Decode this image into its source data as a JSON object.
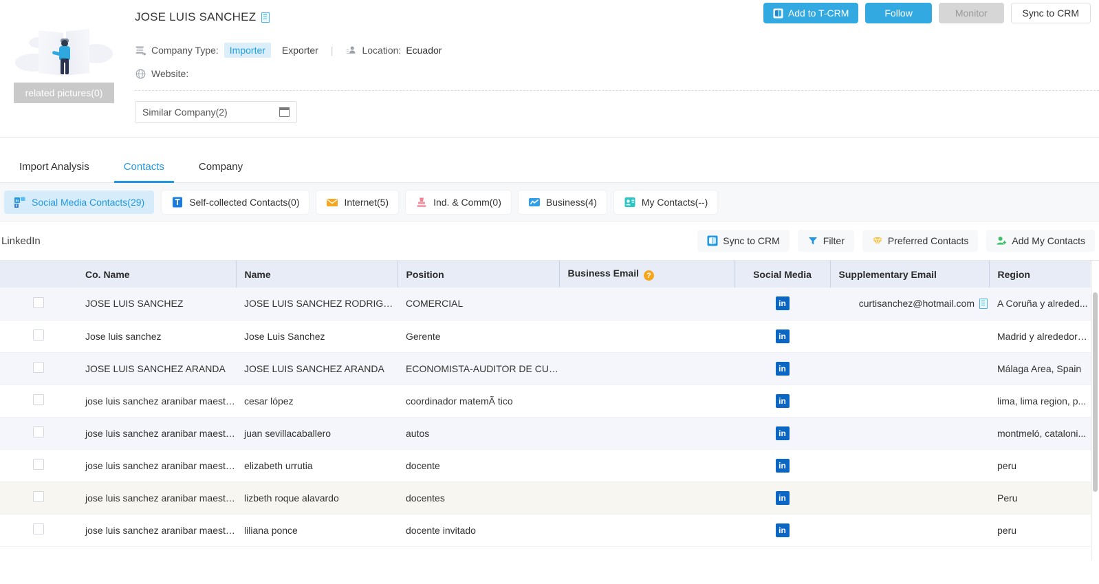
{
  "profile": {
    "thumb_caption": "related pictures(0)",
    "thumb_icon": "person-placeholder-illustration",
    "company_name": "JOSE LUIS SANCHEZ",
    "copy_icon": "copy-icon",
    "company_type_label": "Company Type:",
    "company_type_importer": "Importer",
    "company_type_exporter": "Exporter",
    "divider": "|",
    "location_label": "Location:",
    "location_value": "Ecuador",
    "website_label": "Website:",
    "website_value": "",
    "company_type_icon": "import-export-icon",
    "location_icon": "location-person-icon",
    "website_icon": "globe-icon",
    "similar_company": "Similar Company(2)",
    "similar_company_icon": "calendar-icon"
  },
  "header_actions": [
    {
      "label": "Add to T-CRM",
      "icon": "crm-icon",
      "style": "primary-icon"
    },
    {
      "label": "Follow",
      "icon": "",
      "style": "primary"
    },
    {
      "label": "Monitor",
      "icon": "",
      "style": "disabled"
    },
    {
      "label": "Sync to CRM",
      "icon": "",
      "style": "outline"
    }
  ],
  "tabs": [
    {
      "label": "Import Analysis",
      "active": false
    },
    {
      "label": "Contacts",
      "active": true
    },
    {
      "label": "Company",
      "active": false
    }
  ],
  "chips": [
    {
      "label": "Social Media Contacts(29)",
      "icon": "social-media-icon",
      "active": true
    },
    {
      "label": "Self-collected Contacts(0)",
      "icon": "t-square-icon",
      "active": false
    },
    {
      "label": "Internet(5)",
      "icon": "envelope-icon",
      "active": false
    },
    {
      "label": "Ind. & Comm(0)",
      "icon": "stamp-icon",
      "active": false
    },
    {
      "label": "Business(4)",
      "icon": "chart-icon",
      "active": false
    },
    {
      "label": "My Contacts(--)",
      "icon": "contact-card-icon",
      "active": false
    }
  ],
  "list_toolbar": {
    "source_label": "LinkedIn",
    "buttons": [
      {
        "label": "Sync to CRM",
        "icon": "crm-icon"
      },
      {
        "label": "Filter",
        "icon": "funnel-icon"
      },
      {
        "label": "Preferred Contacts",
        "icon": "diamond-icon"
      },
      {
        "label": "Add My Contacts",
        "icon": "add-person-icon"
      }
    ]
  },
  "table": {
    "columns": [
      "Co. Name",
      "Name",
      "Position",
      "Business Email",
      "Social Media",
      "Supplementary Email",
      "Region"
    ],
    "business_email_help_icon": "help-icon",
    "rows": [
      {
        "co_name": "JOSE LUIS SANCHEZ",
        "name": "JOSE LUIS SANCHEZ RODRIGUEZ",
        "position": "COMERCIAL",
        "business_email": "",
        "social_media": "in",
        "supplementary_email": "curtisanchez@hotmail.com",
        "supplementary_email_copy_icon": "copy-icon",
        "region": "A Coruña y alreded..."
      },
      {
        "co_name": "Jose luis sanchez",
        "name": "Jose Luis Sanchez",
        "position": "Gerente",
        "business_email": "",
        "social_media": "in",
        "supplementary_email": "",
        "region": "Madrid y alrededore..."
      },
      {
        "co_name": "JOSE LUIS SANCHEZ ARANDA",
        "name": "JOSE LUIS SANCHEZ ARANDA",
        "position": "ECONOMISTA-AUDITOR DE CUENTAS",
        "business_email": "",
        "social_media": "in",
        "supplementary_email": "",
        "region": "Málaga Area, Spain"
      },
      {
        "co_name": "jose luis sanchez aranibar maestranza y...",
        "name": "cesar lópez",
        "position": "coordinador matemÃ tico",
        "business_email": "",
        "social_media": "in",
        "supplementary_email": "",
        "region": "lima, lima region, p..."
      },
      {
        "co_name": "jose luis sanchez aranibar maestranza y...",
        "name": "juan sevillacaballero",
        "position": "autos",
        "business_email": "",
        "social_media": "in",
        "supplementary_email": "",
        "region": "montmeló, cataloni..."
      },
      {
        "co_name": "jose luis sanchez aranibar maestranza y...",
        "name": "elizabeth urrutia",
        "position": "docente",
        "business_email": "",
        "social_media": "in",
        "supplementary_email": "",
        "region": "peru"
      },
      {
        "co_name": "jose luis sanchez aranibar maestranza y...",
        "name": "lizbeth roque alavardo",
        "position": "docentes",
        "business_email": "",
        "social_media": "in",
        "supplementary_email": "",
        "region": "Peru"
      },
      {
        "co_name": "jose luis sanchez aranibar maestranza y...",
        "name": "liliana ponce",
        "position": "docente invitado",
        "business_email": "",
        "social_media": "in",
        "supplementary_email": "",
        "region": "peru"
      }
    ]
  },
  "colors": {
    "accent": "#2198e3",
    "chip_active_bg": "#d6ecfa",
    "header_bg": "#e8ecf6",
    "row_alt": "#f4f6fb",
    "row_hover": "#f8f6f0",
    "linkedin": "#0a66c2",
    "help_orange": "#f4a71d"
  }
}
